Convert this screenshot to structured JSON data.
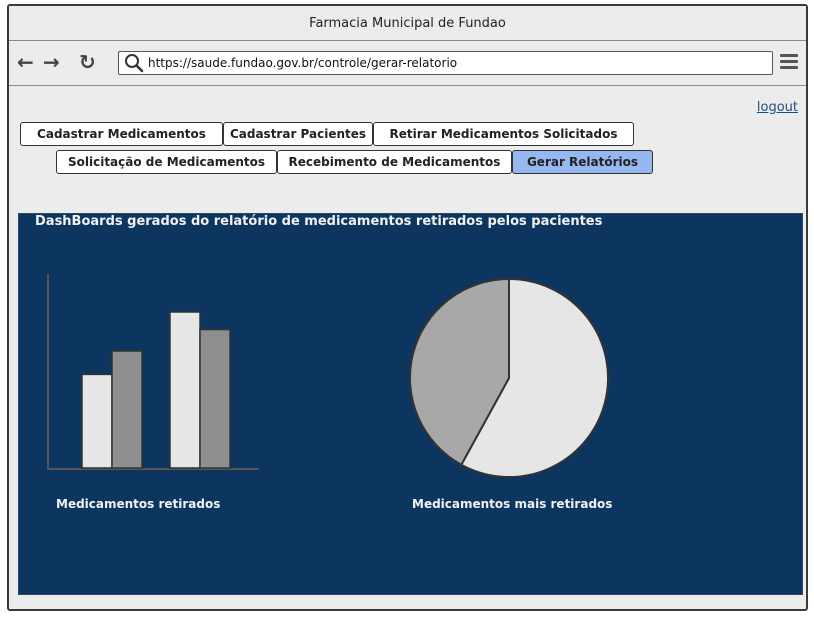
{
  "window": {
    "title": "Farmacia Municipal de Fundao"
  },
  "browser": {
    "url": "https://saude.fundao.gov.br/controle/gerar-relatorio",
    "back_icon": "arrow-left",
    "forward_icon": "arrow-right",
    "reload_icon": "reload",
    "search_icon": "magnifier",
    "menu_icon": "hamburger"
  },
  "header": {
    "logout": "logout"
  },
  "nav": {
    "row1": [
      "Cadastrar Medicamentos",
      "Cadastrar Pacientes",
      "Retirar Medicamentos Solicitados"
    ],
    "row2": [
      "Solicitação de Medicamentos",
      "Recebimento de Medicamentos",
      "Gerar Relatórios"
    ],
    "active": "Gerar Relatórios",
    "active_color": "#94b8ef"
  },
  "dashboard": {
    "title": "DashBoards gerados do relatório de medicamentos retirados pelos pacientes",
    "background": "#0c365f",
    "bar_caption": "Medicamentos retirados",
    "pie_caption": "Medicamentos mais retirados"
  },
  "chart_data": [
    {
      "type": "bar",
      "title": "Medicamentos retirados",
      "categories": [
        "",
        ""
      ],
      "series": [
        {
          "values": [
            48,
            80
          ],
          "color": "#e6e6e6"
        },
        {
          "values": [
            60,
            71
          ],
          "color": "#8f8f8f"
        }
      ],
      "ylim": [
        0,
        100
      ],
      "grid": false
    },
    {
      "type": "pie",
      "title": "Medicamentos mais retirados",
      "values": [
        58,
        42
      ],
      "colors": [
        "#e6e6e6",
        "#a8a8a8"
      ]
    }
  ]
}
